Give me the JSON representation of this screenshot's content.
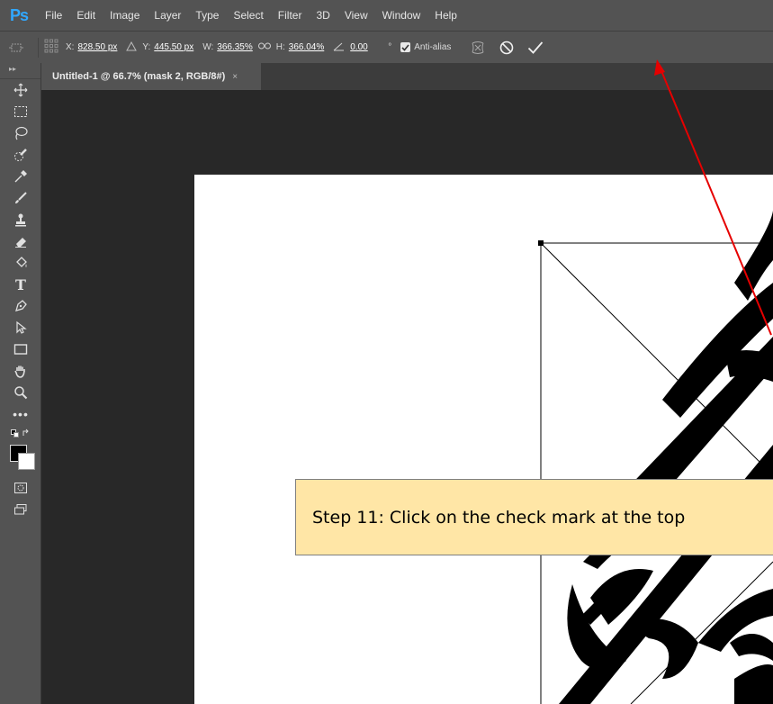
{
  "app": {
    "logo": "Ps"
  },
  "menu": [
    "File",
    "Edit",
    "Image",
    "Layer",
    "Type",
    "Select",
    "Filter",
    "3D",
    "View",
    "Window",
    "Help"
  ],
  "options": {
    "x_label": "X:",
    "x_value": "828.50 px",
    "y_label": "Y:",
    "y_value": "445.50 px",
    "w_label": "W:",
    "w_value": "366.35%",
    "h_label": "H:",
    "h_value": "366.04%",
    "angle_value": "0.00",
    "angle_unit": "°",
    "antialias_label": "Anti-alias",
    "antialias_checked": true
  },
  "document_tab": {
    "title": "Untitled-1 @ 66.7% (mask 2, RGB/8#)",
    "close": "×"
  },
  "tools": [
    "move-tool",
    "marquee-tool",
    "lasso-tool",
    "quick-selection-tool",
    "eyedropper-tool",
    "brush-tool",
    "clone-stamp-tool",
    "eraser-tool",
    "paint-bucket-tool",
    "type-tool",
    "pen-tool",
    "path-selection-tool",
    "rectangle-tool",
    "hand-tool",
    "zoom-tool",
    "more-tools"
  ],
  "colors": {
    "foreground": "#000000",
    "background": "#ffffff",
    "ui_dark": "#535353",
    "workspace": "#282828",
    "callout": "#ffe6a6",
    "arrow": "#e60000"
  },
  "annotation": {
    "text": "Step 11: Click on the check mark at the top"
  }
}
